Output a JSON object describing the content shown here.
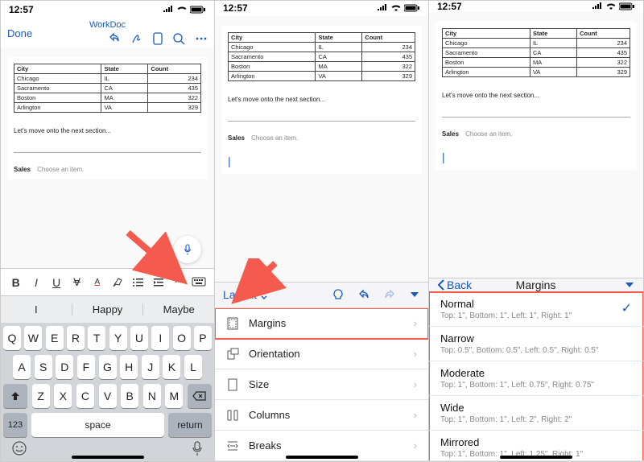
{
  "status": {
    "time": "12:57"
  },
  "header": {
    "done": "Done",
    "title": "WorkDoc"
  },
  "table": {
    "cols": [
      "City",
      "State",
      "Count"
    ],
    "rows": [
      [
        "Chicago",
        "IL",
        "234"
      ],
      [
        "Sacramento",
        "CA",
        "435"
      ],
      [
        "Boston",
        "MA",
        "322"
      ],
      [
        "Arlington",
        "VA",
        "329"
      ]
    ]
  },
  "body_text": "Let's move onto the next section...",
  "sales": {
    "label": "Sales",
    "placeholder": "Choose an item."
  },
  "suggestions": [
    "I",
    "Happy",
    "Maybe"
  ],
  "keyboard": {
    "r1": [
      "Q",
      "W",
      "E",
      "R",
      "T",
      "Y",
      "U",
      "I",
      "O",
      "P"
    ],
    "r2": [
      "A",
      "S",
      "D",
      "F",
      "G",
      "H",
      "J",
      "K",
      "L"
    ],
    "r3": [
      "Z",
      "X",
      "C",
      "V",
      "B",
      "N",
      "M"
    ],
    "num": "123",
    "space": "space",
    "return": "return"
  },
  "layout_panel": {
    "tab": "Layout",
    "items": [
      {
        "name": "Margins"
      },
      {
        "name": "Orientation"
      },
      {
        "name": "Size"
      },
      {
        "name": "Columns"
      },
      {
        "name": "Breaks"
      }
    ]
  },
  "margins_panel": {
    "back": "Back",
    "title": "Margins",
    "options": [
      {
        "name": "Normal",
        "desc": "Top: 1\", Bottom: 1\", Left: 1\", Right: 1\"",
        "selected": true
      },
      {
        "name": "Narrow",
        "desc": "Top: 0.5\", Bottom: 0.5\", Left: 0.5\", Right: 0.5\""
      },
      {
        "name": "Moderate",
        "desc": "Top: 1\", Bottom: 1\", Left: 0.75\", Right: 0.75\""
      },
      {
        "name": "Wide",
        "desc": "Top: 1\", Bottom: 1\", Left: 2\", Right: 2\""
      },
      {
        "name": "Mirrored",
        "desc": "Top: 1\", Bottom: 1\", Left: 1.25\", Right: 1\""
      }
    ]
  }
}
